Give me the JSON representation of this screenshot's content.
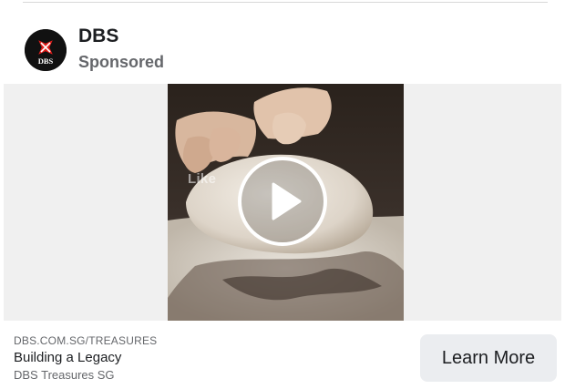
{
  "ad": {
    "page_name": "DBS",
    "sponsored_label": "Sponsored",
    "logo_text": "DBS",
    "watermark_text": "Like",
    "domain": "DBS.COM.SG/TREASURES",
    "headline": "Building a Legacy",
    "description": "DBS Treasures SG",
    "cta_label": "Learn More"
  },
  "colors": {
    "brand_red": "#e31d1a",
    "text_primary": "#1c1e21",
    "text_secondary": "#65676b",
    "cta_background": "#ebedf0"
  },
  "icons": {
    "logo": "dbs-logo-icon",
    "play": "play-icon"
  }
}
